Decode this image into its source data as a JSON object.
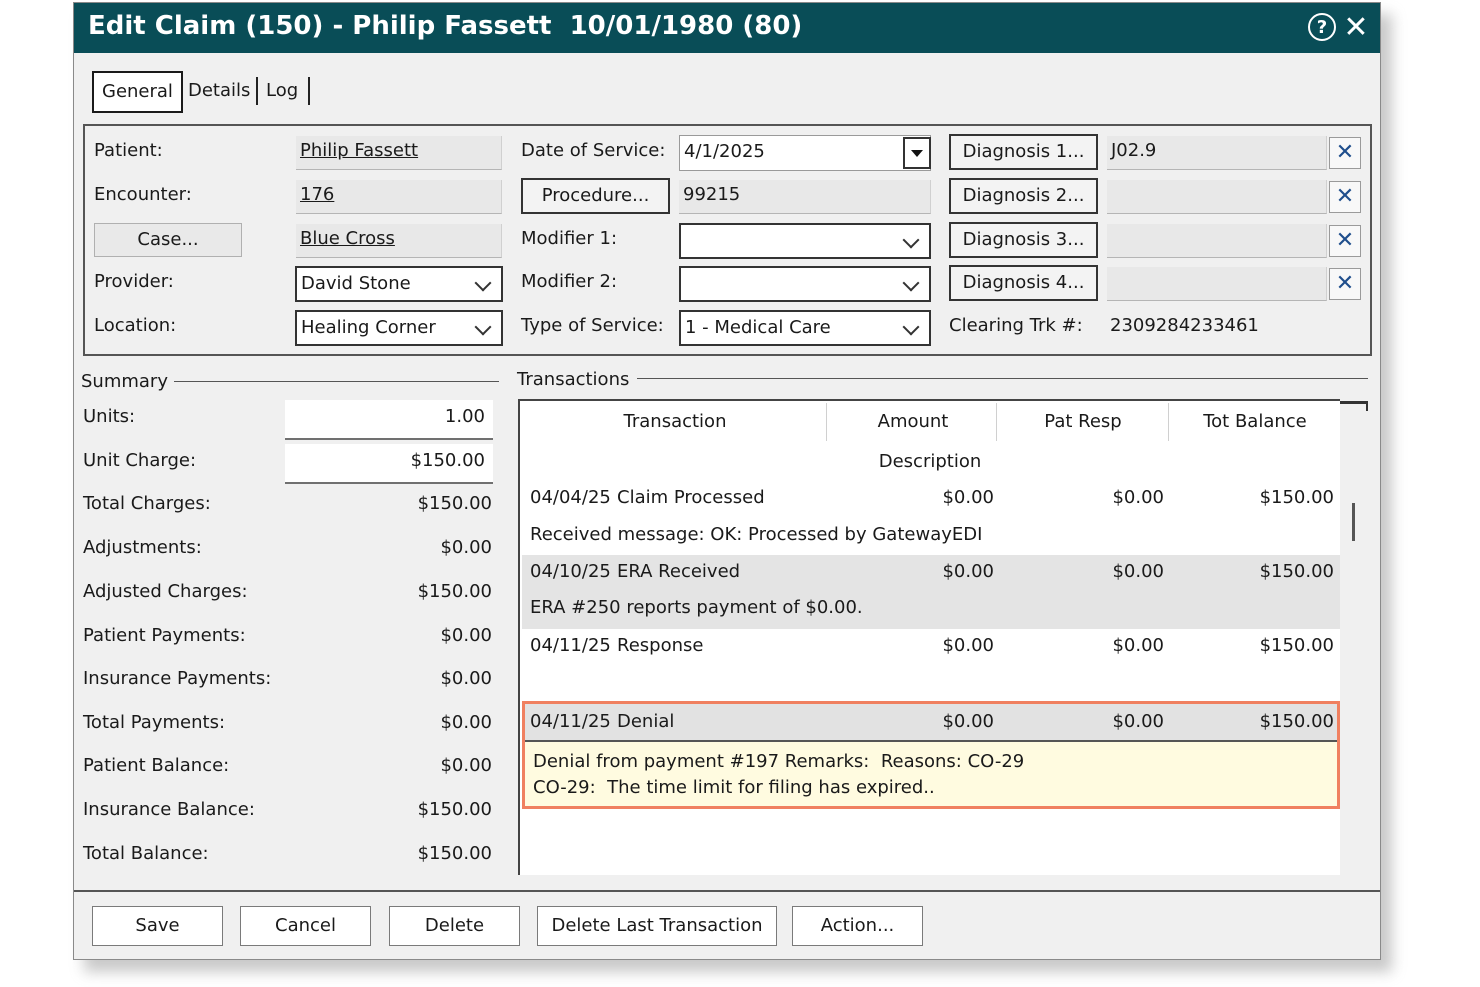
{
  "window": {
    "title": "Edit Claim (150) - Philip Fassett  10/01/1980 (80)",
    "help_glyph": "?",
    "close_glyph": "✕",
    "accent": "#094d57",
    "highlight_border": "#f08060",
    "highlight_fill": "#fffbe0"
  },
  "tabs": [
    "General",
    "Details",
    "Log"
  ],
  "claim": {
    "patient_label": "Patient:",
    "patient": "Philip Fassett",
    "encounter_label": "Encounter:",
    "encounter": "176",
    "case_button": "Case...",
    "case": "Blue Cross",
    "provider_label": "Provider:",
    "provider": "David Stone",
    "location_label": "Location:",
    "location": "Healing Corner",
    "dos_label": "Date of Service:",
    "dos": "4/1/2025",
    "procedure_button": "Procedure...",
    "procedure": "99215",
    "modifier1_label": "Modifier 1:",
    "modifier1": "",
    "modifier2_label": "Modifier 2:",
    "modifier2": "",
    "tos_label": "Type of Service:",
    "tos": "1 - Medical Care",
    "diagnosis": [
      {
        "button": "Diagnosis 1...",
        "value": "J02.9"
      },
      {
        "button": "Diagnosis 2...",
        "value": ""
      },
      {
        "button": "Diagnosis 3...",
        "value": ""
      },
      {
        "button": "Diagnosis 4...",
        "value": ""
      }
    ],
    "clear_glyph": "✕",
    "clearing_label": "Clearing Trk #:",
    "clearing": "2309284233461"
  },
  "summary": {
    "heading": "Summary",
    "rows": [
      {
        "label": "Units:",
        "value": "1.00"
      },
      {
        "label": "Unit Charge:",
        "value": "$150.00"
      },
      {
        "label": "Total Charges:",
        "value": "$150.00"
      },
      {
        "label": "Adjustments:",
        "value": "$0.00"
      },
      {
        "label": "Adjusted Charges:",
        "value": "$150.00"
      },
      {
        "label": "Patient Payments:",
        "value": "$0.00"
      },
      {
        "label": "Insurance Payments:",
        "value": "$0.00"
      },
      {
        "label": "Total Payments:",
        "value": "$0.00"
      },
      {
        "label": "Patient Balance:",
        "value": "$0.00"
      },
      {
        "label": "Insurance Balance:",
        "value": "$150.00"
      },
      {
        "label": "Total Balance:",
        "value": "$150.00"
      }
    ]
  },
  "transactions": {
    "heading": "Transactions",
    "columns": [
      "Transaction",
      "Amount",
      "Pat Resp",
      "Tot Balance"
    ],
    "description_header": "Description",
    "rows": [
      {
        "date": "04/04/25",
        "type": "Claim Processed",
        "amount": "$0.00",
        "pat_resp": "$0.00",
        "tot_balance": "$150.00",
        "description": "Received message: OK: Processed by GatewayEDI"
      },
      {
        "date": "04/10/25",
        "type": "ERA Received",
        "amount": "$0.00",
        "pat_resp": "$0.00",
        "tot_balance": "$150.00",
        "description": "ERA #250 reports payment of $0.00."
      },
      {
        "date": "04/11/25",
        "type": "Response",
        "amount": "$0.00",
        "pat_resp": "$0.00",
        "tot_balance": "$150.00",
        "description": ""
      },
      {
        "date": "04/11/25",
        "type": "Denial",
        "amount": "$0.00",
        "pat_resp": "$0.00",
        "tot_balance": "$150.00",
        "description": "Denial from payment #197 Remarks:  Reasons: CO-29",
        "description2": "CO-29:  The time limit for filing has expired.."
      }
    ]
  },
  "buttons": {
    "save": "Save",
    "cancel": "Cancel",
    "delete": "Delete",
    "delete_last": "Delete Last Transaction",
    "action": "Action..."
  }
}
